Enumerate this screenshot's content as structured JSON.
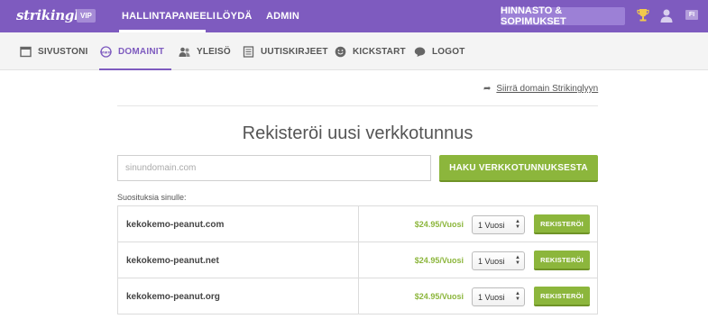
{
  "app": {
    "logo_text": "strikingly",
    "badge": "VIP"
  },
  "topnav": {
    "items": [
      "HALLINTAPANEELI",
      "LÖYDÄ",
      "ADMIN"
    ],
    "pricing_label": "HINNASTO & SOPIMUKSET",
    "language": "FI"
  },
  "subnav": {
    "items": [
      {
        "label": "SIVUSTONI",
        "icon": "browser-window-icon"
      },
      {
        "label": "DOMAINIT",
        "icon": "www-globe-icon",
        "active": true
      },
      {
        "label": "YLEISÖ",
        "icon": "users-icon"
      },
      {
        "label": "UUTISKIRJEET",
        "icon": "newsletter-icon"
      },
      {
        "label": "KICKSTART",
        "icon": "smiley-icon"
      },
      {
        "label": "LOGOT",
        "icon": "logo-bubble-icon"
      }
    ]
  },
  "main": {
    "transfer_link": "Siirrä domain Strikinglyyn",
    "title": "Rekisteröi uusi verkkotunnus",
    "search_placeholder": "sinundomain.com",
    "search_button": "HAKU VERKKOTUNNUKSESTA",
    "suggestions_label": "Suosituksia sinulle:",
    "suggestions": [
      {
        "domain": "kekokemo-peanut.com",
        "price": "$24.95/Vuosi",
        "period": "1 Vuosi",
        "button": "REKISTERÖI"
      },
      {
        "domain": "kekokemo-peanut.net",
        "price": "$24.95/Vuosi",
        "period": "1 Vuosi",
        "button": "REKISTERÖI"
      },
      {
        "domain": "kekokemo-peanut.org",
        "price": "$24.95/Vuosi",
        "period": "1 Vuosi",
        "button": "REKISTERÖI"
      }
    ]
  },
  "colors": {
    "brand_purple": "#7e5bbf",
    "accent_green": "#8cb63c"
  }
}
